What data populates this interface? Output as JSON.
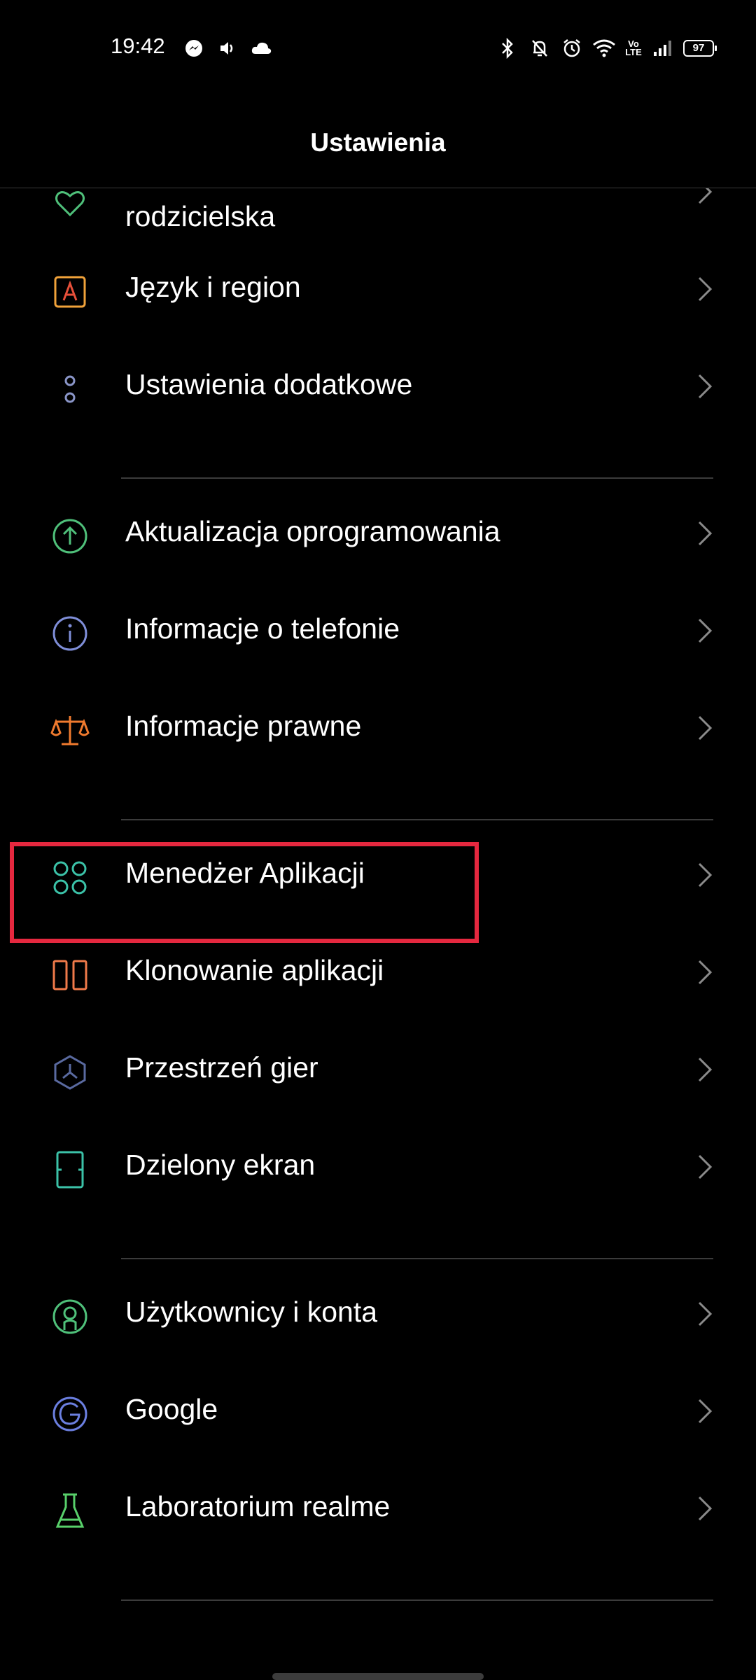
{
  "status_bar": {
    "time": "19:42",
    "left_icons": [
      "messenger-icon",
      "volume-icon",
      "cloud-icon"
    ],
    "right_icons": [
      "bluetooth-icon",
      "bell-off-icon",
      "alarm-icon",
      "wifi-icon",
      "volte-icon",
      "signal-icon"
    ],
    "volte_text": "Vo\nLTE",
    "battery_level": "97"
  },
  "header": {
    "title": "Ustawienia"
  },
  "list": {
    "partial_item": {
      "label_line2": "rodzicielska",
      "icon": "heart-icon",
      "color": "#4fc07a"
    },
    "items": [
      {
        "label": "Język i region",
        "icon": "language-icon",
        "color": "#f0a23a"
      },
      {
        "label": "Ustawienia dodatkowe",
        "icon": "more-icon",
        "color": "#8a95c8"
      },
      {
        "label": "Aktualizacja oprogramowania",
        "icon": "update-icon",
        "color": "#4fc07a"
      },
      {
        "label": "Informacje o telefonie",
        "icon": "info-icon",
        "color": "#7f8ed8"
      },
      {
        "label": "Informacje prawne",
        "icon": "scale-icon",
        "color": "#f07a2e"
      },
      {
        "label": "Menedżer Aplikacji",
        "icon": "app-manager-icon",
        "color": "#3bc2a8"
      },
      {
        "label": "Klonowanie aplikacji",
        "icon": "clone-icon",
        "color": "#f07a4a"
      },
      {
        "label": "Przestrzeń gier",
        "icon": "game-space-icon",
        "color": "#5a6aa0"
      },
      {
        "label": "Dzielony ekran",
        "icon": "split-screen-icon",
        "color": "#3bc2a8"
      },
      {
        "label": "Użytkownicy i konta",
        "icon": "users-icon",
        "color": "#4fc07a"
      },
      {
        "label": "Google",
        "icon": "google-icon",
        "color": "#6b7fe0"
      },
      {
        "label": "Laboratorium realme",
        "icon": "flask-icon",
        "color": "#58d06a"
      }
    ]
  },
  "highlight_color": "#e5283f"
}
